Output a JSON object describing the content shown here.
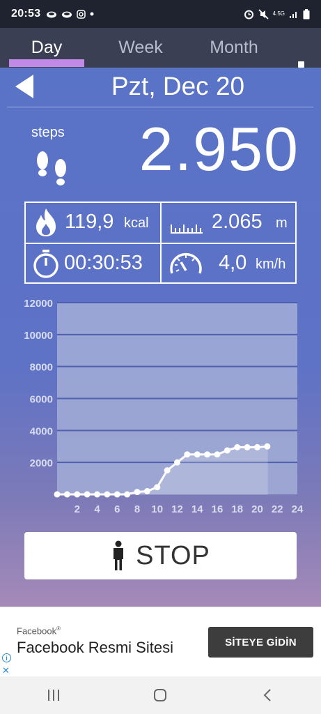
{
  "status_bar": {
    "time": "20:53",
    "notification_icons": [
      "cloud-icon",
      "cloud-icon",
      "instagram-icon",
      "dot-icon"
    ],
    "system_icons": [
      "alarm-icon",
      "mute-icon",
      "network-4g-icon",
      "signal-icon",
      "battery-icon"
    ],
    "network_label": "4.5G"
  },
  "tabs": [
    {
      "label": "Day",
      "active": true
    },
    {
      "label": "Week",
      "active": false
    },
    {
      "label": "Month",
      "active": false
    }
  ],
  "date": {
    "label": "Pzt, Dec 20"
  },
  "steps": {
    "label": "steps",
    "value": "2.950"
  },
  "stats": {
    "calories": {
      "value": "119,9",
      "unit": "kcal"
    },
    "distance": {
      "value": "2.065",
      "unit": "m"
    },
    "duration": {
      "value": "00:30:53"
    },
    "speed": {
      "value": "4,0",
      "unit": "km/h"
    }
  },
  "chart_data": {
    "type": "area",
    "title": "",
    "xlabel": "",
    "ylabel": "",
    "ylim": [
      0,
      12000
    ],
    "xlim": [
      0,
      24
    ],
    "y_ticks": [
      2000,
      4000,
      6000,
      8000,
      10000,
      12000
    ],
    "x_ticks": [
      2,
      4,
      6,
      8,
      10,
      12,
      14,
      16,
      18,
      20,
      22,
      24
    ],
    "grid": true,
    "legend": "none",
    "series": [
      {
        "x": [
          0,
          1,
          2,
          3,
          4,
          5,
          6,
          7,
          8,
          9,
          10,
          11,
          12,
          13,
          14,
          15,
          16,
          17,
          18,
          19,
          20,
          21
        ],
        "y": [
          0,
          0,
          0,
          0,
          0,
          0,
          0,
          0,
          150,
          200,
          450,
          1500,
          2000,
          2500,
          2500,
          2500,
          2500,
          2750,
          2950,
          2950,
          2950,
          3000
        ]
      }
    ],
    "colors": {
      "line": "#ffffff",
      "plot_bg": "#a3aed6",
      "grid": "#4f5fb0"
    }
  },
  "stop_button": {
    "label": "STOP"
  },
  "ad": {
    "brand": "Facebook",
    "title": "Facebook Resmi Sitesi",
    "cta": "SİTEYE GİDİN"
  }
}
